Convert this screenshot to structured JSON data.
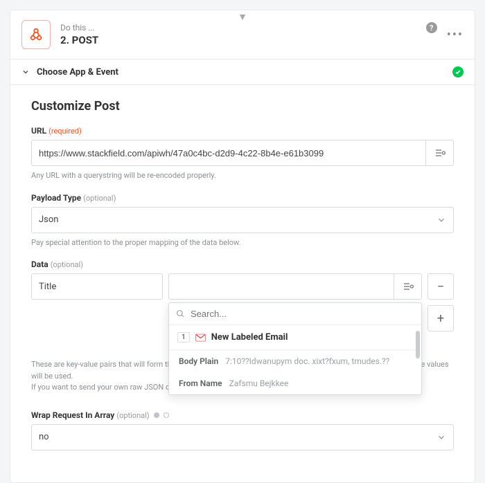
{
  "header": {
    "pre_label": "Do this ...",
    "title": "2. POST"
  },
  "choose_row": {
    "label": "Choose App & Event"
  },
  "section": {
    "title": "Customize Post",
    "url": {
      "label": "URL",
      "badge": "(required)",
      "value": "https://www.stackfield.com/apiwh/47a0c4bc-d2d9-4c22-8b4e-e61b3099",
      "hint": "Any URL with a querystring will be re-encoded properly."
    },
    "payload": {
      "label": "Payload Type",
      "badge": "(optional)",
      "value": "Json",
      "hint": "Pay special attention to the proper mapping of the data below."
    },
    "data": {
      "label": "Data",
      "badge": "(optional)",
      "key": "Title",
      "hint_line1": "These are key-value pairs that will form the data portion of the request. The keys will become the field names and the values will be used.",
      "hint_line2": "If you want to send your own raw JSON or form-encoded values, use the Raw Data field instead."
    },
    "wrap": {
      "label": "Wrap Request In Array",
      "badge": "(optional)",
      "value": "no"
    }
  },
  "dropdown": {
    "search_placeholder": "Search...",
    "source_step": "1",
    "source_label": "New Labeled Email",
    "items": [
      {
        "k": "Body Plain",
        "v": "7:10??Idwanupym doc. xixt?fxum, tmudes.??"
      },
      {
        "k": "From Name",
        "v": "Zafsmu Bejkkee"
      }
    ]
  }
}
